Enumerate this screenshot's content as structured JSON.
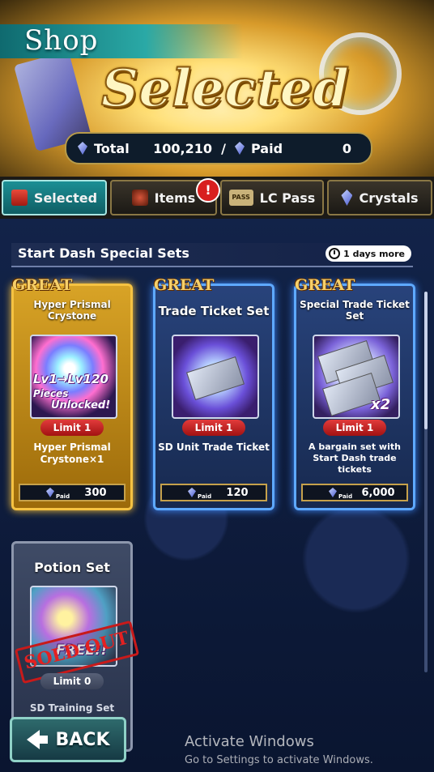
{
  "header": {
    "shop_label": "Shop",
    "banner_title": "Selected",
    "currency": {
      "total_label": "Total",
      "total_value": "100,210",
      "separator": "/",
      "paid_label": "Paid",
      "paid_value": "0"
    }
  },
  "tabs": [
    {
      "label": "Selected",
      "active": true
    },
    {
      "label": "Items",
      "active": false,
      "alert": "!"
    },
    {
      "label": "LC Pass",
      "active": false,
      "icon_text": "PASS"
    },
    {
      "label": "Crystals",
      "active": false
    }
  ],
  "section": {
    "title": "Start Dash Special Sets",
    "timer": "1 days more"
  },
  "cards": [
    {
      "badge": "GREAT",
      "name": "Hyper Prismal Crystone",
      "overlay_lv": "Lv1→Lv120",
      "overlay_pieces": "Pieces",
      "overlay_unlocked": "Unlocked!",
      "limit": "Limit 1",
      "description": "Hyper Prismal Crystone×1",
      "price_label": "Paid",
      "price": "300"
    },
    {
      "badge": "GREAT",
      "name": "Trade Ticket Set",
      "limit": "Limit 1",
      "description": "SD Unit Trade Ticket",
      "price_label": "Paid",
      "price": "120"
    },
    {
      "badge": "GREAT",
      "name": "Special Trade Ticket Set",
      "overlay_count": "x2",
      "limit": "Limit 1",
      "description": "A bargain set with Start Dash trade tickets",
      "price_label": "Paid",
      "price": "6,000"
    },
    {
      "name": "Potion Set",
      "stamp": "SOLD OUT",
      "overlay_free": "FREE!!",
      "limit": "Limit 0",
      "description": "SD Training Set"
    }
  ],
  "back_button": "BACK",
  "watermark": {
    "title": "Activate Windows",
    "subtitle": "Go to Settings to activate Windows."
  },
  "colors": {
    "accent_teal": "#1c8f95",
    "gold": "#f5c242",
    "limit_red": "#d21f1f",
    "card_blue": "#5ea9ff"
  }
}
